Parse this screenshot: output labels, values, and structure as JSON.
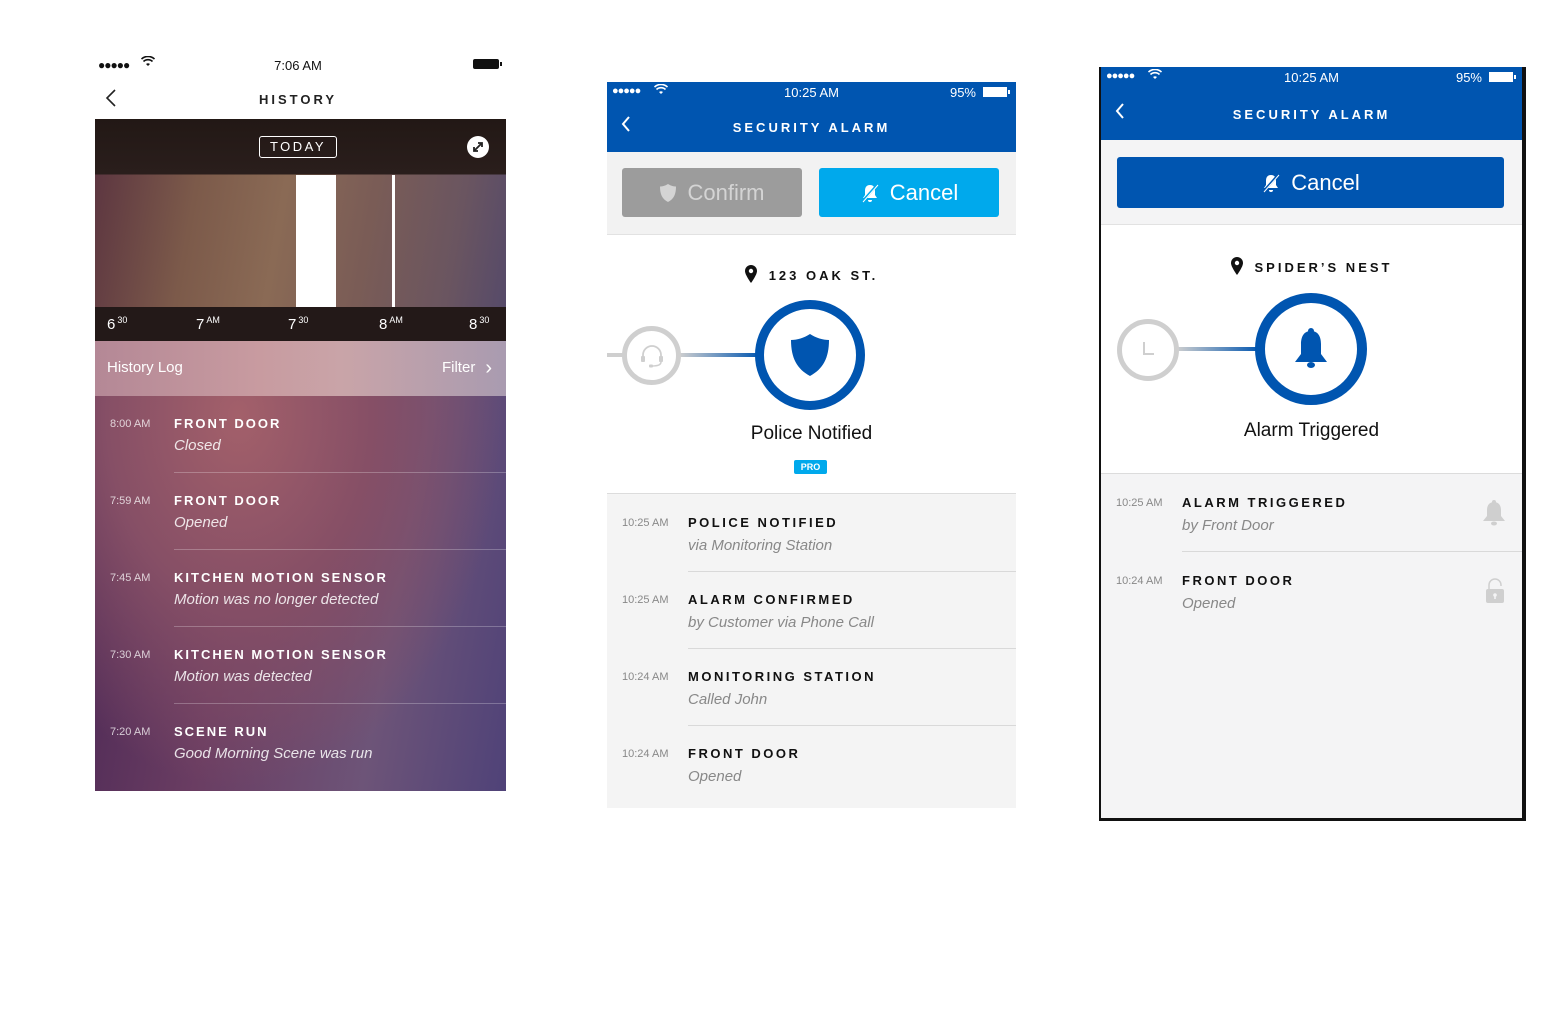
{
  "history_screen": {
    "status_bar": {
      "signal": "●●●●●",
      "time": "7:06 AM"
    },
    "title": "HISTORY",
    "timeline": {
      "today_label": "TODAY",
      "ticks": [
        {
          "main": "6",
          "sup": "30"
        },
        {
          "main": "7",
          "sup": "AM"
        },
        {
          "main": "7",
          "sup": "30"
        },
        {
          "main": "8",
          "sup": "AM"
        },
        {
          "main": "8",
          "sup": "30"
        }
      ]
    },
    "log_header": {
      "label": "History Log",
      "filter": "Filter"
    },
    "entries": [
      {
        "time": "8:00 AM",
        "title": "FRONT DOOR",
        "detail": "Closed"
      },
      {
        "time": "7:59 AM",
        "title": "FRONT DOOR",
        "detail": "Opened"
      },
      {
        "time": "7:45 AM",
        "title": "KITCHEN MOTION SENSOR",
        "detail": "Motion was no longer detected"
      },
      {
        "time": "7:30 AM",
        "title": "KITCHEN MOTION SENSOR",
        "detail": "Motion was detected"
      },
      {
        "time": "7:20 AM",
        "title": "SCENE RUN",
        "detail": "Good Morning Scene was run"
      }
    ]
  },
  "alarm_screen_pro": {
    "status_bar": {
      "signal": "●●●●●",
      "time": "10:25 AM",
      "battery": "95%"
    },
    "title": "SECURITY ALARM",
    "confirm_label": "Confirm",
    "cancel_label": "Cancel",
    "location": "123 OAK ST.",
    "state": "Police Notified",
    "badge": "PRO",
    "entries": [
      {
        "time": "10:25 AM",
        "title": "POLICE NOTIFIED",
        "detail": "via Monitoring Station"
      },
      {
        "time": "10:25 AM",
        "title": "ALARM CONFIRMED",
        "detail": "by Customer via Phone Call"
      },
      {
        "time": "10:24 AM",
        "title": "MONITORING STATION",
        "detail": "Called John"
      },
      {
        "time": "10:24 AM",
        "title": "FRONT DOOR",
        "detail": "Opened"
      }
    ]
  },
  "alarm_screen_basic": {
    "status_bar": {
      "signal": "●●●●●",
      "time": "10:25 AM",
      "battery": "95%"
    },
    "title": "SECURITY ALARM",
    "cancel_label": "Cancel",
    "location": "SPIDER’S NEST",
    "state": "Alarm Triggered",
    "entries": [
      {
        "time": "10:25 AM",
        "title": "ALARM TRIGGERED",
        "detail": "by Front Door",
        "icon": "bell-icon"
      },
      {
        "time": "10:24 AM",
        "title": "FRONT DOOR",
        "detail": "Opened",
        "icon": "lock-icon"
      }
    ]
  },
  "colors": {
    "brand_blue": "#0055b0",
    "cancel_cyan": "#00a9ec",
    "disabled_gray": "#9c9c9c"
  }
}
